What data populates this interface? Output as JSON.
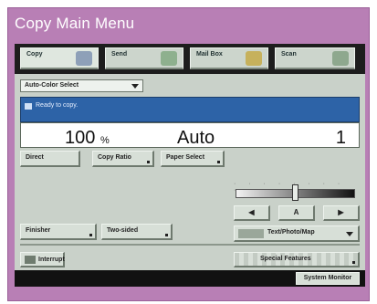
{
  "caption": "Copy Main Menu",
  "tabs": [
    {
      "label": "Copy",
      "icon": "copy-icon"
    },
    {
      "label": "Send",
      "icon": "send-icon"
    },
    {
      "label": "Mail Box",
      "icon": "mailbox-icon"
    },
    {
      "label": "Scan",
      "icon": "scan-icon"
    }
  ],
  "color_select": {
    "value": "Auto-Color Select"
  },
  "status": {
    "text": "Ready to copy."
  },
  "display": {
    "ratio": "100",
    "ratio_unit": "%",
    "mode": "Auto",
    "copies": "1"
  },
  "buttons": {
    "direct": "Direct",
    "copy_ratio": "Copy Ratio",
    "paper_select": "Paper Select",
    "finisher": "Finisher",
    "two_sided": "Two-sided",
    "interrupt": "Interrupt",
    "special_features": "Special Features",
    "system_monitor": "System Monitor"
  },
  "density": {
    "dots": "·  ·  ·  ·  ·  ·  ·  ·  ·",
    "lighter": "◀",
    "auto": "A",
    "darker": "▶",
    "level": 0.5
  },
  "original_type": {
    "value": "Text/Photo/Map"
  },
  "colors": {
    "frame": "#b87fb5",
    "status": "#2d63a7",
    "screen": "#c9d1c9",
    "tabbar": "#1d1d1d"
  }
}
